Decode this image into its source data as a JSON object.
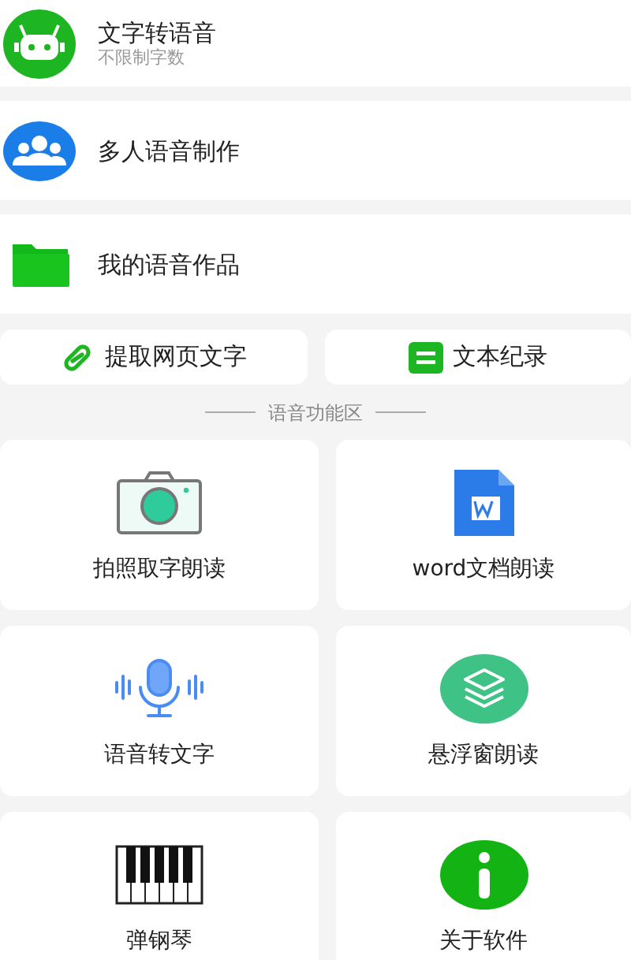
{
  "menu": [
    {
      "title": "文字转语音",
      "subtitle": "不限制字数"
    },
    {
      "title": "多人语音制作"
    },
    {
      "title": "我的语音作品"
    }
  ],
  "quick_buttons": [
    {
      "label": "提取网页文字"
    },
    {
      "label": "文本纪录"
    }
  ],
  "section_title": "语音功能区",
  "tiles": [
    {
      "label": "拍照取字朗读"
    },
    {
      "label": "word文档朗读"
    },
    {
      "label": "语音转文字"
    },
    {
      "label": "悬浮窗朗读"
    },
    {
      "label": "弹钢琴"
    },
    {
      "label": "关于软件"
    }
  ]
}
